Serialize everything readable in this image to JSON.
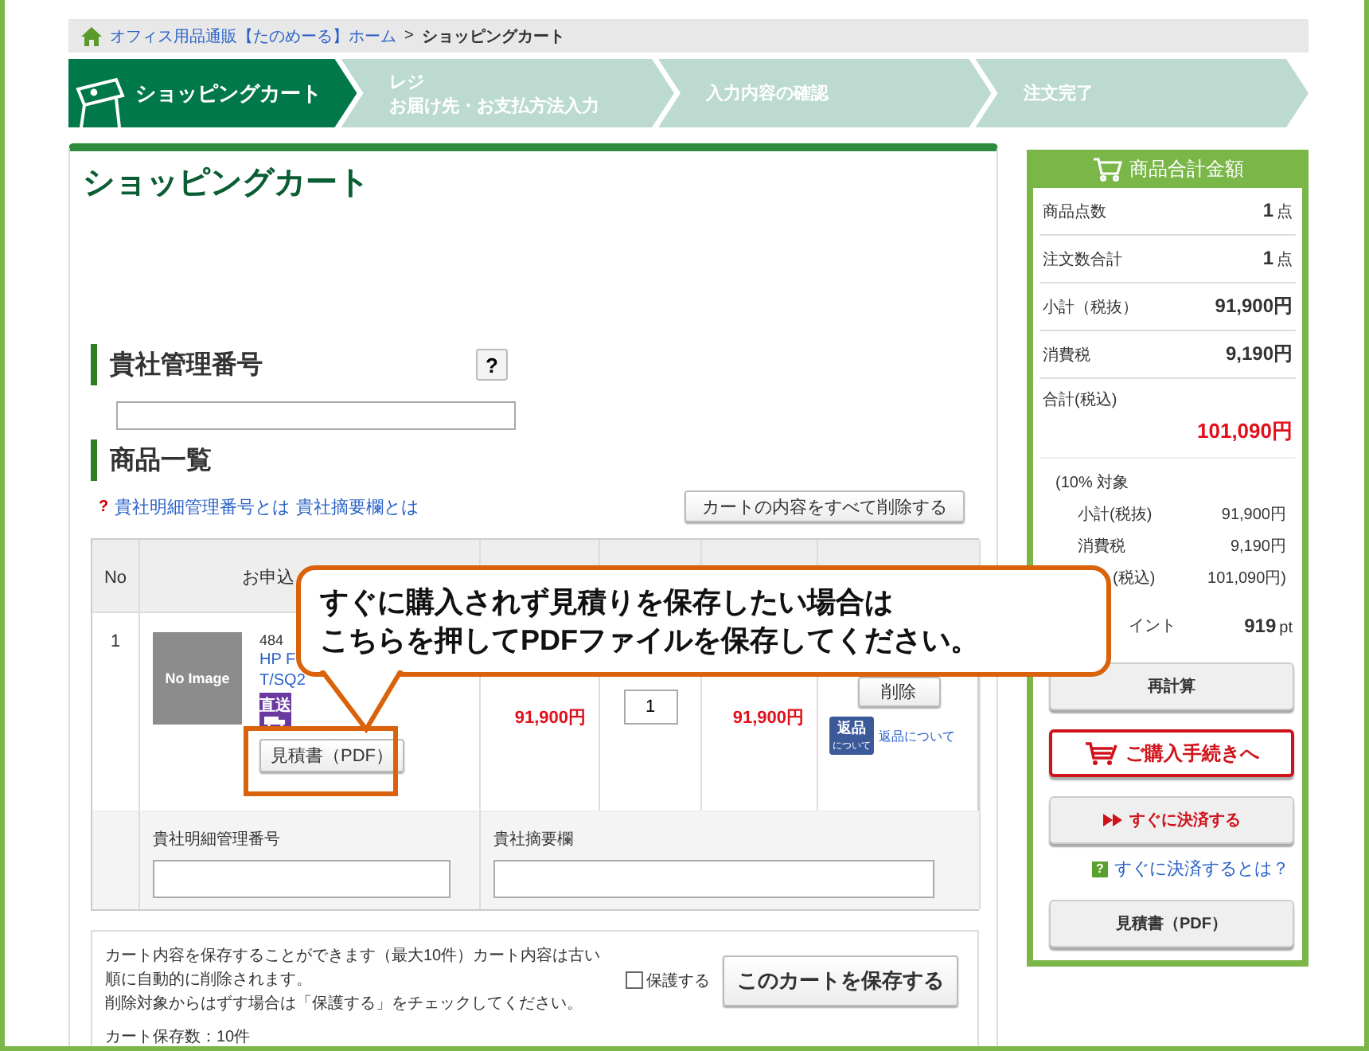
{
  "breadcrumb": {
    "home": "オフィス用品通販【たのめーる】ホーム",
    "separator": ">",
    "current": "ショッピングカート"
  },
  "steps": [
    {
      "lines": [
        "ショッピングカート"
      ],
      "selected": true
    },
    {
      "lines": [
        "レジ",
        "お届け先・お支払方法入力"
      ],
      "selected": false
    },
    {
      "lines": [
        "入力内容の確認"
      ],
      "selected": false
    },
    {
      "lines": [
        "注文完了"
      ],
      "selected": false
    }
  ],
  "page_title": "ショッピングカート",
  "company_ref": {
    "heading": "貴社管理番号",
    "help": "?"
  },
  "product_list": {
    "heading": "商品一覧",
    "help_mark": "?",
    "help_links": [
      "貴社明細管理番号とは",
      "貴社摘要欄とは"
    ],
    "clear_button": "カートの内容をすべて削除する",
    "columns": [
      "No",
      "お申込"
    ],
    "rows": [
      {
        "no": "1",
        "image": "No Image",
        "code": "484",
        "name_lines": [
          "HP F",
          "T/SQ2"
        ],
        "badge": "直送",
        "pdf_button": "見積書（PDF）",
        "price": "91,900円",
        "quantity": "1",
        "subtotal": "91,900円",
        "delete_button": "削除",
        "return_badge": [
          "返品",
          "について"
        ],
        "return_link": "返品について",
        "ref_label": "貴社明細管理番号",
        "memo_label": "貴社摘要欄"
      }
    ]
  },
  "save_box": {
    "lines": [
      "カート内容を保存することができます（最大10件）カート内容は古い順に自動的に削除されます。",
      "削除対象からはずす場合は「保護する」をチェックしてください。"
    ],
    "protect": {
      "label": "保護する",
      "checked": false
    },
    "save_button": "このカートを保存する",
    "count": "カート保存数：10件"
  },
  "summary": {
    "title": "商品合計金額",
    "rows": [
      {
        "label": "商品点数",
        "value": "1",
        "unit": "点"
      },
      {
        "label": "注文数合計",
        "value": "1",
        "unit": "点"
      },
      {
        "label": "小計（税抜）",
        "value": "91,900円"
      },
      {
        "label": "消費税",
        "value": "9,190円"
      }
    ],
    "total": {
      "label": "合計(税込)",
      "value": "101,090円"
    },
    "breakdown": {
      "heading": "(10% 対象",
      "rows": [
        {
          "label": "小計(税抜)",
          "value": "91,900円"
        },
        {
          "label": "消費税",
          "value": "9,190円"
        },
        {
          "label": "(税込)",
          "value": "101,090円)"
        }
      ]
    },
    "points": {
      "label": "イント",
      "value": "919",
      "unit": "pt"
    },
    "buttons": [
      {
        "kind": "plain",
        "label": "再計算"
      },
      {
        "kind": "checkout",
        "label": "ご購入手続きへ"
      },
      {
        "kind": "express",
        "label": "すぐに決済する"
      },
      {
        "kind": "help",
        "icon": "?",
        "label": "すぐに決済するとは？"
      },
      {
        "kind": "plain",
        "label": "見積書（PDF）"
      }
    ]
  },
  "callout": {
    "lines": [
      "すぐに購入されず見積りを保存したい場合は",
      "こちらを押してPDFファイルを保存してください。"
    ]
  }
}
